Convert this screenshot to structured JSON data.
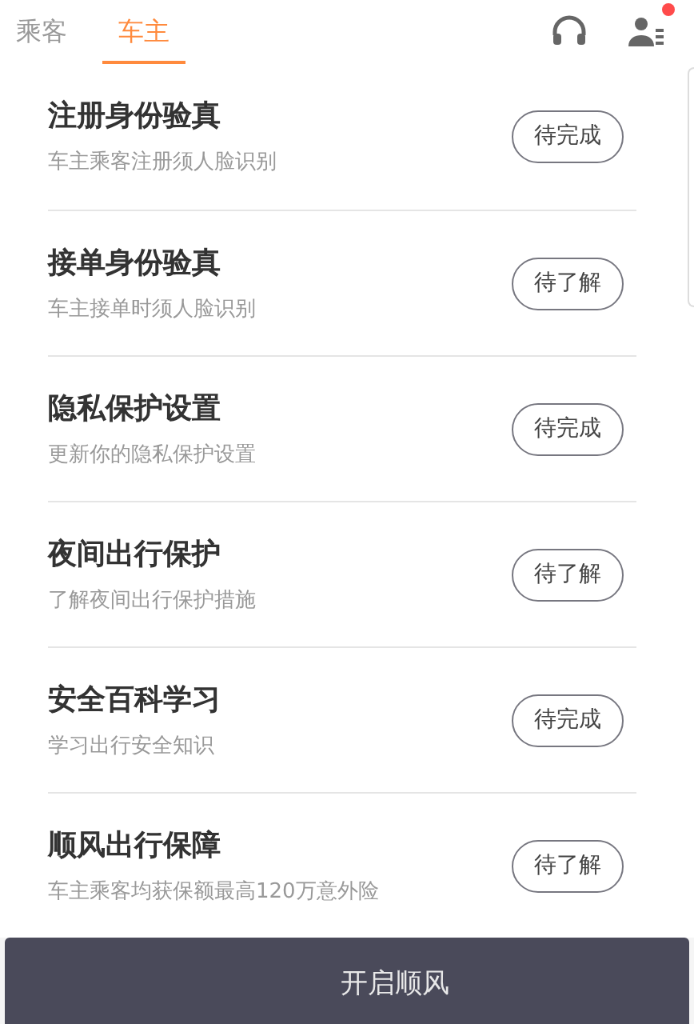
{
  "tabs": [
    {
      "label": "乘客",
      "selected": false
    },
    {
      "label": "车主",
      "selected": true
    }
  ],
  "header": {
    "profile_notification": true
  },
  "items": [
    {
      "title": "注册身份验真",
      "subtitle": "车主乘客注册须人脸识别",
      "action": "待完成"
    },
    {
      "title": "接单身份验真",
      "subtitle": "车主接单时须人脸识别",
      "action": "待了解"
    },
    {
      "title": "隐私保护设置",
      "subtitle": "更新你的隐私保护设置",
      "action": "待完成"
    },
    {
      "title": "夜间出行保护",
      "subtitle": "了解夜间出行保护措施",
      "action": "待了解"
    },
    {
      "title": "安全百科学习",
      "subtitle": "学习出行安全知识",
      "action": "待完成"
    },
    {
      "title": "顺风出行保障",
      "subtitle": "车主乘客均获保额最高120万意外险",
      "action": "待了解"
    }
  ],
  "bottom_bar": {
    "label": "开启顺风"
  }
}
